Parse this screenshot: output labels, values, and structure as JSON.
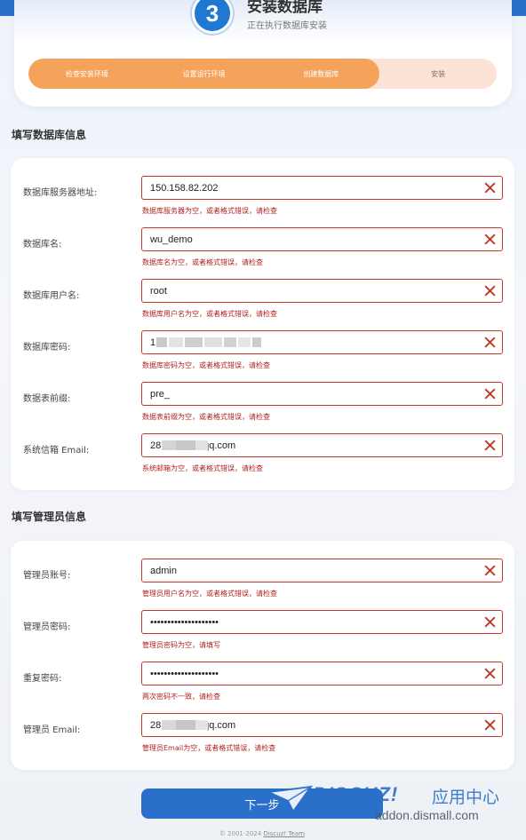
{
  "step": {
    "number": "3",
    "title": "安装数据库",
    "subtitle": "正在执行数据库安装",
    "progress_fraction": 0.75,
    "steps": [
      "检查安装环境",
      "设置运行环境",
      "创建数据库",
      "安装"
    ]
  },
  "db_section": {
    "title": "填写数据库信息",
    "fields": [
      {
        "label": "数据库服务器地址:",
        "value": "150.158.82.202",
        "error": "数据库服务器为空，或者格式错误，请检查"
      },
      {
        "label": "数据库名:",
        "value": "wu_demo",
        "error": "数据库名为空，或者格式错误，请检查"
      },
      {
        "label": "数据库用户名:",
        "value": "root",
        "error": "数据库用户名为空，或者格式错误，请检查"
      },
      {
        "label": "数据库密码:",
        "value": "1",
        "error": "数据库密码为空，或者格式错误，请检查"
      },
      {
        "label": "数据表前缀:",
        "value": "pre_",
        "error": "数据表前缀为空，或者格式错误，请检查"
      },
      {
        "label": "系统信箱 Email:",
        "value": "28          6@qq.com",
        "error": "系统邮箱为空，或者格式错误，请检查"
      }
    ]
  },
  "admin_section": {
    "title": "填写管理员信息",
    "fields": [
      {
        "label": "管理员账号:",
        "value": "admin",
        "error": "管理员用户名为空，或者格式错误，请检查"
      },
      {
        "label": "管理员密码:",
        "value": "••••••••••••••••••••",
        "error": "管理员密码为空，请填写"
      },
      {
        "label": "重复密码:",
        "value": "••••••••••••••••••••",
        "error": "两次密码不一致，请检查"
      },
      {
        "label": "管理员 Email:",
        "value": "28          6@qq.com",
        "error": "管理员Email为空，或者格式错误，请检查"
      }
    ]
  },
  "next_button_label": "下一步",
  "footer": {
    "copyright": "© 2001-2024 ",
    "team_link": "Discuz! Team",
    "suffix": "."
  },
  "watermark": {
    "logo": "DISCUZ!",
    "cn": "应用中心",
    "url": "addon.dismall.com"
  },
  "colors": {
    "accent_blue": "#2a6fc9",
    "progress_orange": "#f5a35a",
    "progress_track": "#fde3d6",
    "error_red": "#b22222"
  }
}
